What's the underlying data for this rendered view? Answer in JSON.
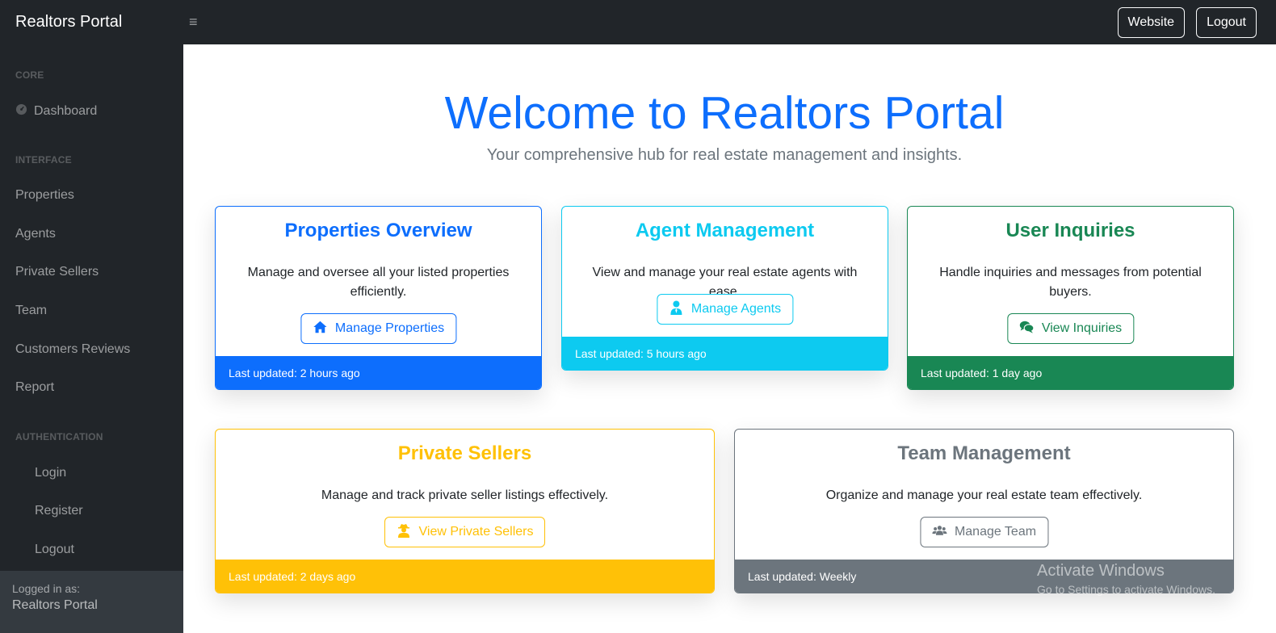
{
  "topbar": {
    "brand": "Realtors Portal",
    "toggle_icon": "≡",
    "website_label": "Website",
    "logout_label": "Logout"
  },
  "sidebar": {
    "core_heading": "Core",
    "dashboard_label": "Dashboard",
    "interface_heading": "Interface",
    "items": [
      {
        "label": "Properties"
      },
      {
        "label": "Agents"
      },
      {
        "label": "Private Sellers"
      },
      {
        "label": "Team"
      },
      {
        "label": "Customers Reviews"
      },
      {
        "label": "Report"
      }
    ],
    "auth_heading": "Authentication",
    "auth_items": [
      {
        "label": "Login"
      },
      {
        "label": "Register"
      },
      {
        "label": "Logout"
      }
    ],
    "footer": {
      "logged_in_label": "Logged in as:",
      "user_name": "Realtors Portal"
    }
  },
  "main": {
    "title": "Welcome to Realtors Portal",
    "subtitle": "Your comprehensive hub for real estate management and insights.",
    "cards": [
      {
        "title": "Properties Overview",
        "text": "Manage and oversee all your listed properties efficiently.",
        "button": "Manage Properties",
        "icon": "home-icon",
        "footer": "Last updated: 2 hours ago",
        "color": "#0d6efd"
      },
      {
        "title": "Agent Management",
        "text": "View and manage your real estate agents with ease.",
        "button": "Manage Agents",
        "icon": "user-tie-icon",
        "footer": "Last updated: 5 hours ago",
        "color": "#0dcaf0"
      },
      {
        "title": "User Inquiries",
        "text": "Handle inquiries and messages from potential buyers.",
        "button": "View Inquiries",
        "icon": "comments-icon",
        "footer": "Last updated: 1 day ago",
        "color": "#198754"
      },
      {
        "title": "Private Sellers",
        "text": "Manage and track private seller listings effectively.",
        "button": "View Private Sellers",
        "icon": "user-secret-icon",
        "footer": "Last updated: 2 days ago",
        "color": "#ffc107"
      },
      {
        "title": "Team Management",
        "text": "Organize and manage your real estate team effectively.",
        "button": "Manage Team",
        "icon": "users-icon",
        "footer": "Last updated: Weekly",
        "color": "#6c757d"
      }
    ]
  },
  "watermark": {
    "line1": "Activate Windows",
    "line2": "Go to Settings to activate Windows."
  }
}
